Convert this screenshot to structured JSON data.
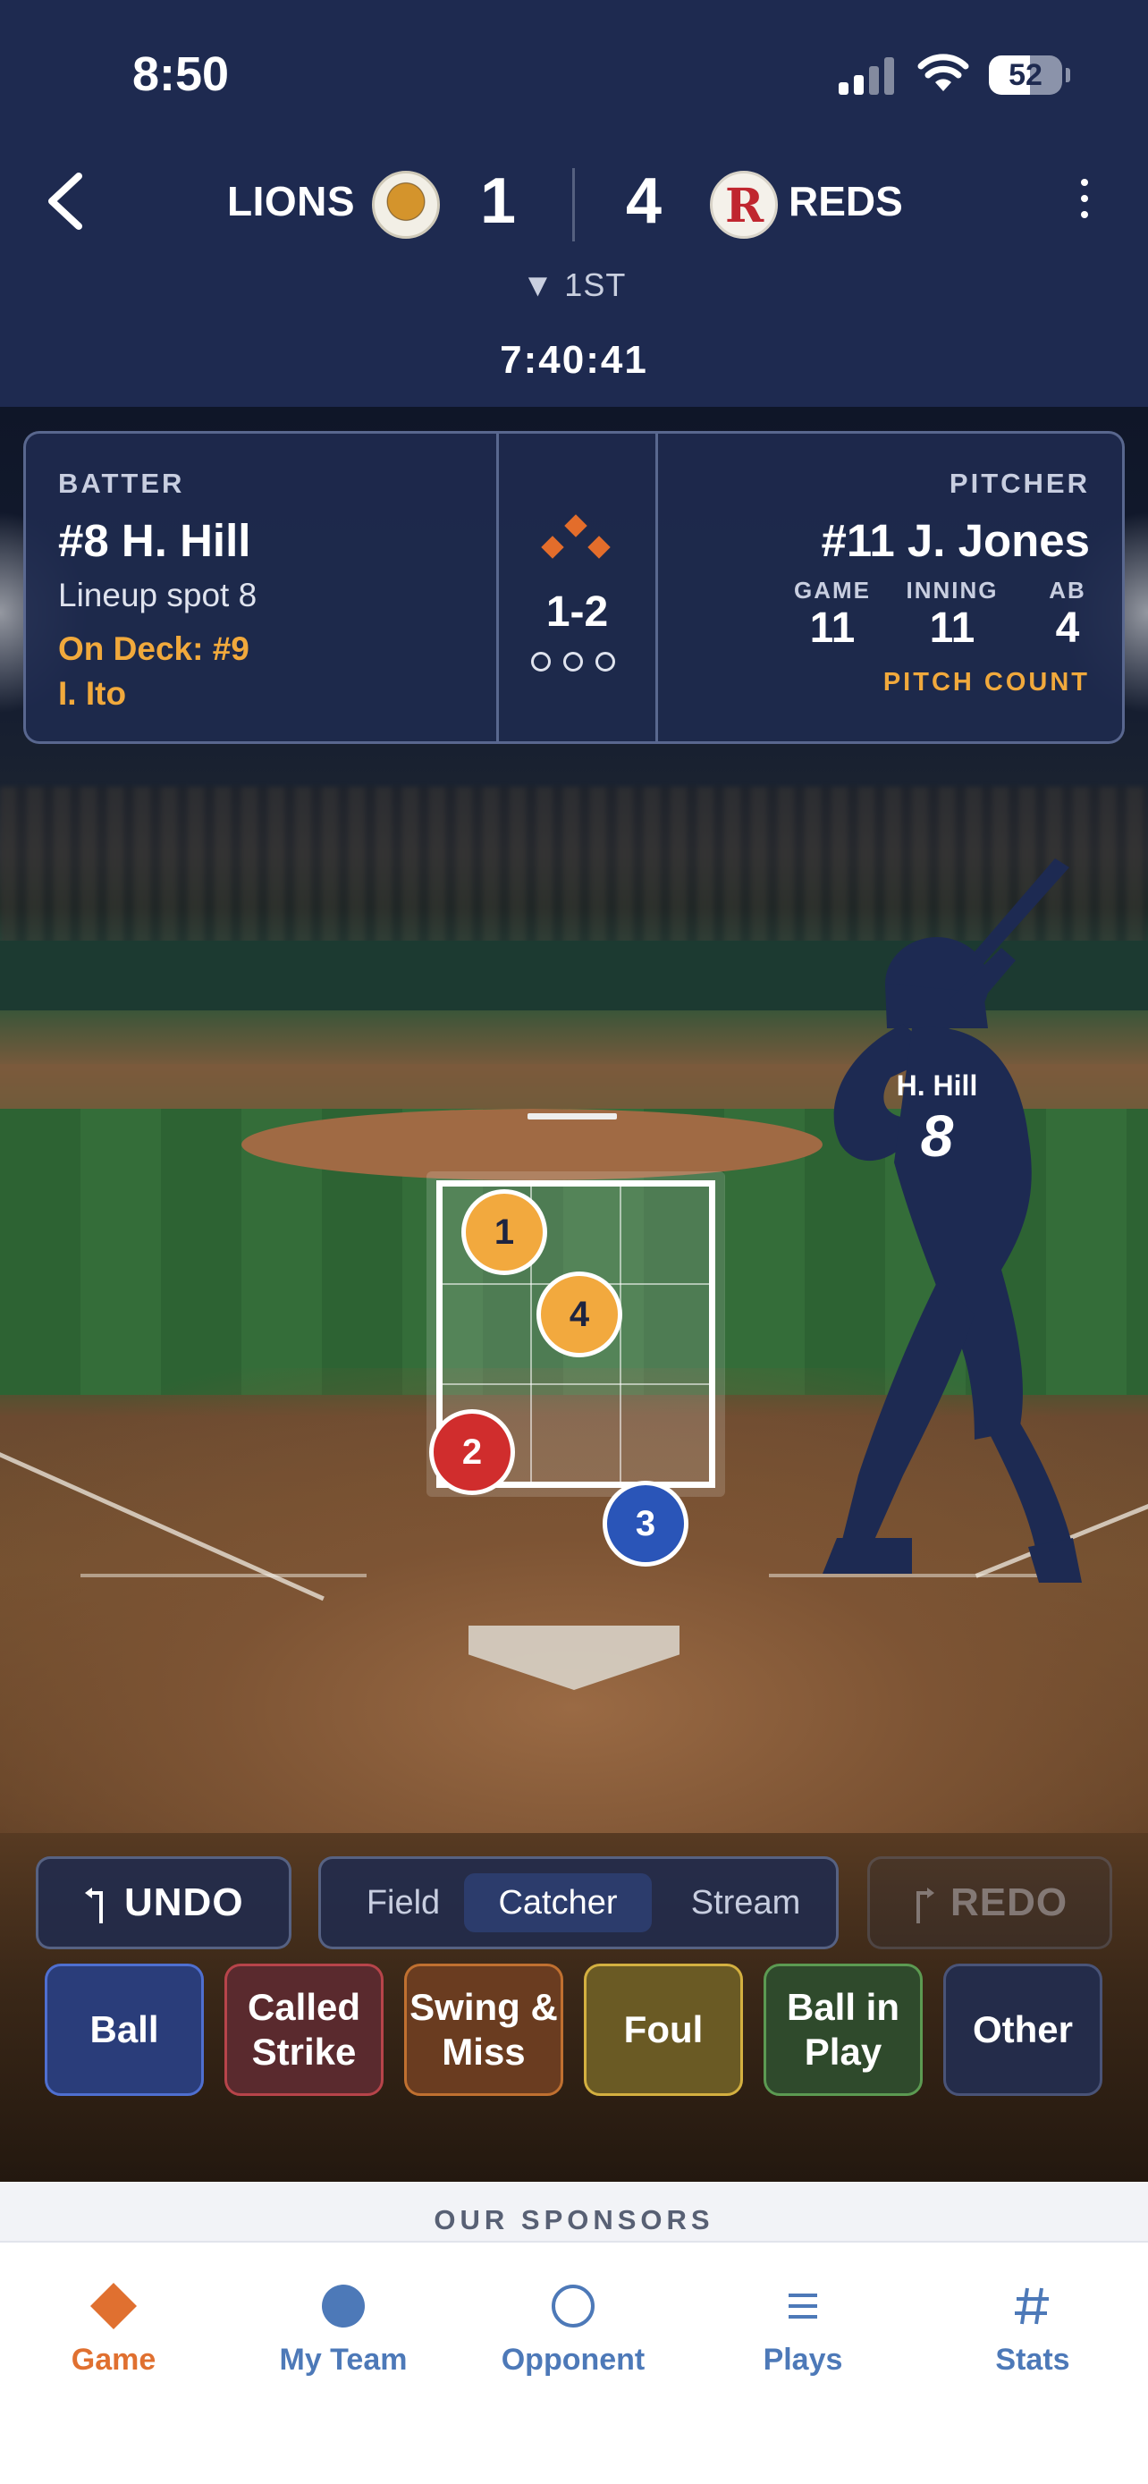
{
  "status_bar": {
    "time": "8:50",
    "battery": "52"
  },
  "scoreboard": {
    "away_team": "LIONS",
    "away_score": "1",
    "home_team": "REDS",
    "home_score": "4",
    "home_logo_letter": "R",
    "inning": "▼ 1ST",
    "clock": "7:40:41"
  },
  "at_bat": {
    "batter_label": "BATTER",
    "batter_name": "#8 H. Hill",
    "lineup": "Lineup spot 8",
    "on_deck_line1": "On Deck: #9",
    "on_deck_line2": "I. Ito",
    "count": "1-2",
    "pitcher_label": "PITCHER",
    "pitcher_name": "#11 J. Jones",
    "stats": [
      {
        "label": "GAME",
        "value": "11"
      },
      {
        "label": "INNING",
        "value": "11"
      },
      {
        "label": "AB",
        "value": "4"
      }
    ],
    "pitch_count_label": "PITCH COUNT"
  },
  "batter_silhouette": {
    "name": "H. Hill",
    "number": "8"
  },
  "pitches": [
    {
      "label": "1",
      "kind": "strike",
      "color": "#f2a93e"
    },
    {
      "label": "2",
      "kind": "ball",
      "color": "#d02d2d"
    },
    {
      "label": "3",
      "kind": "in-play",
      "color": "#2a55b8"
    },
    {
      "label": "4",
      "kind": "strike",
      "color": "#f2a93e"
    }
  ],
  "controls": {
    "undo": "UNDO",
    "redo": "REDO",
    "views": [
      "Field",
      "Catcher",
      "Stream"
    ],
    "active_view": "Catcher"
  },
  "pitch_buttons": [
    {
      "line1": "Ball",
      "line2": "",
      "color": "#2a3d7a"
    },
    {
      "line1": "Called",
      "line2": "Strike",
      "color": "#5a2a2e"
    },
    {
      "line1": "Swing &",
      "line2": "Miss",
      "color": "#6a3c20"
    },
    {
      "line1": "Foul",
      "line2": "",
      "color": "#6a5a24"
    },
    {
      "line1": "Ball in",
      "line2": "Play",
      "color": "#2f4a2c"
    },
    {
      "line1": "Other",
      "line2": "",
      "color": "#242c4a"
    }
  ],
  "sponsors_label": "OUR SPONSORS",
  "tabbar": {
    "items": [
      {
        "label": "Game",
        "icon": "diamond-icon"
      },
      {
        "label": "My Team",
        "icon": "filled-circle-icon"
      },
      {
        "label": "Opponent",
        "icon": "hollow-circle-icon"
      },
      {
        "label": "Plays",
        "icon": "list-icon"
      },
      {
        "label": "Stats",
        "icon": "hash-icon"
      }
    ],
    "active": "Game",
    "accent_color": "#e07030",
    "inactive_color": "#4d79b8"
  }
}
